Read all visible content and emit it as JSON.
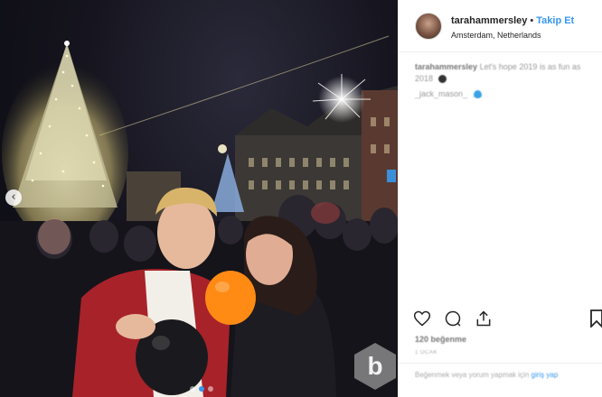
{
  "post": {
    "username": "tarahammersley",
    "separator": "•",
    "follow_label": "Takip Et",
    "location": "Amsterdam, Netherlands",
    "caption_author": "tarahammersley",
    "caption_text": "Let's hope 2019 is as fun as 2018",
    "mention": "_jack_mason_",
    "likes": "120 beğenme",
    "timestamp": "1 OCAK",
    "login_prompt": "Beğenmek veya yorum yapmak için",
    "login_link": "giriş yap",
    "accent_color": "#3897f0",
    "watermark_letter": "b"
  },
  "carousel": {
    "count": 3,
    "active_index": 1
  },
  "icons": {
    "prev": "chevron-left-icon",
    "like": "heart-icon",
    "comment": "comment-icon",
    "share": "share-icon",
    "save": "bookmark-icon"
  }
}
